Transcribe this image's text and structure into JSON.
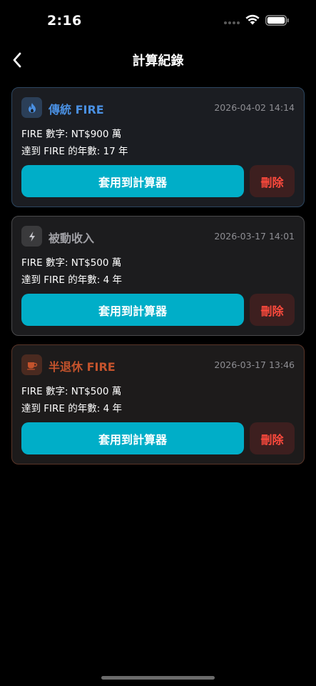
{
  "status_bar": {
    "time": "2:16"
  },
  "nav": {
    "title": "計算紀錄"
  },
  "records": [
    {
      "type_name": "傳統 FIRE",
      "icon": "flame-icon",
      "accent_color": "#4a90e2",
      "timestamp": "2026-04-02 14:14",
      "fire_number": "FIRE 數字: NT$900 萬",
      "years_to_fire": "達到 FIRE 的年數: 17 年",
      "apply_label": "套用到計算器",
      "delete_label": "刪除"
    },
    {
      "type_name": "被動收入",
      "icon": "lightning-icon",
      "accent_color": "#a0a0a5",
      "timestamp": "2026-03-17 14:01",
      "fire_number": "FIRE 數字: NT$500 萬",
      "years_to_fire": "達到 FIRE 的年數: 4 年",
      "apply_label": "套用到計算器",
      "delete_label": "刪除"
    },
    {
      "type_name": "半退休 FIRE",
      "icon": "coffee-cup-icon",
      "accent_color": "#c4532c",
      "timestamp": "2026-03-17 13:46",
      "fire_number": "FIRE 數字: NT$500 萬",
      "years_to_fire": "達到 FIRE 的年數: 4 年",
      "apply_label": "套用到計算器",
      "delete_label": "刪除"
    }
  ],
  "colors": {
    "background": "#000000",
    "card": "#1c1c1e",
    "primary_button": "#00aec8",
    "delete_text": "#ff4a3d",
    "delete_bg": "#3d1f1f"
  }
}
